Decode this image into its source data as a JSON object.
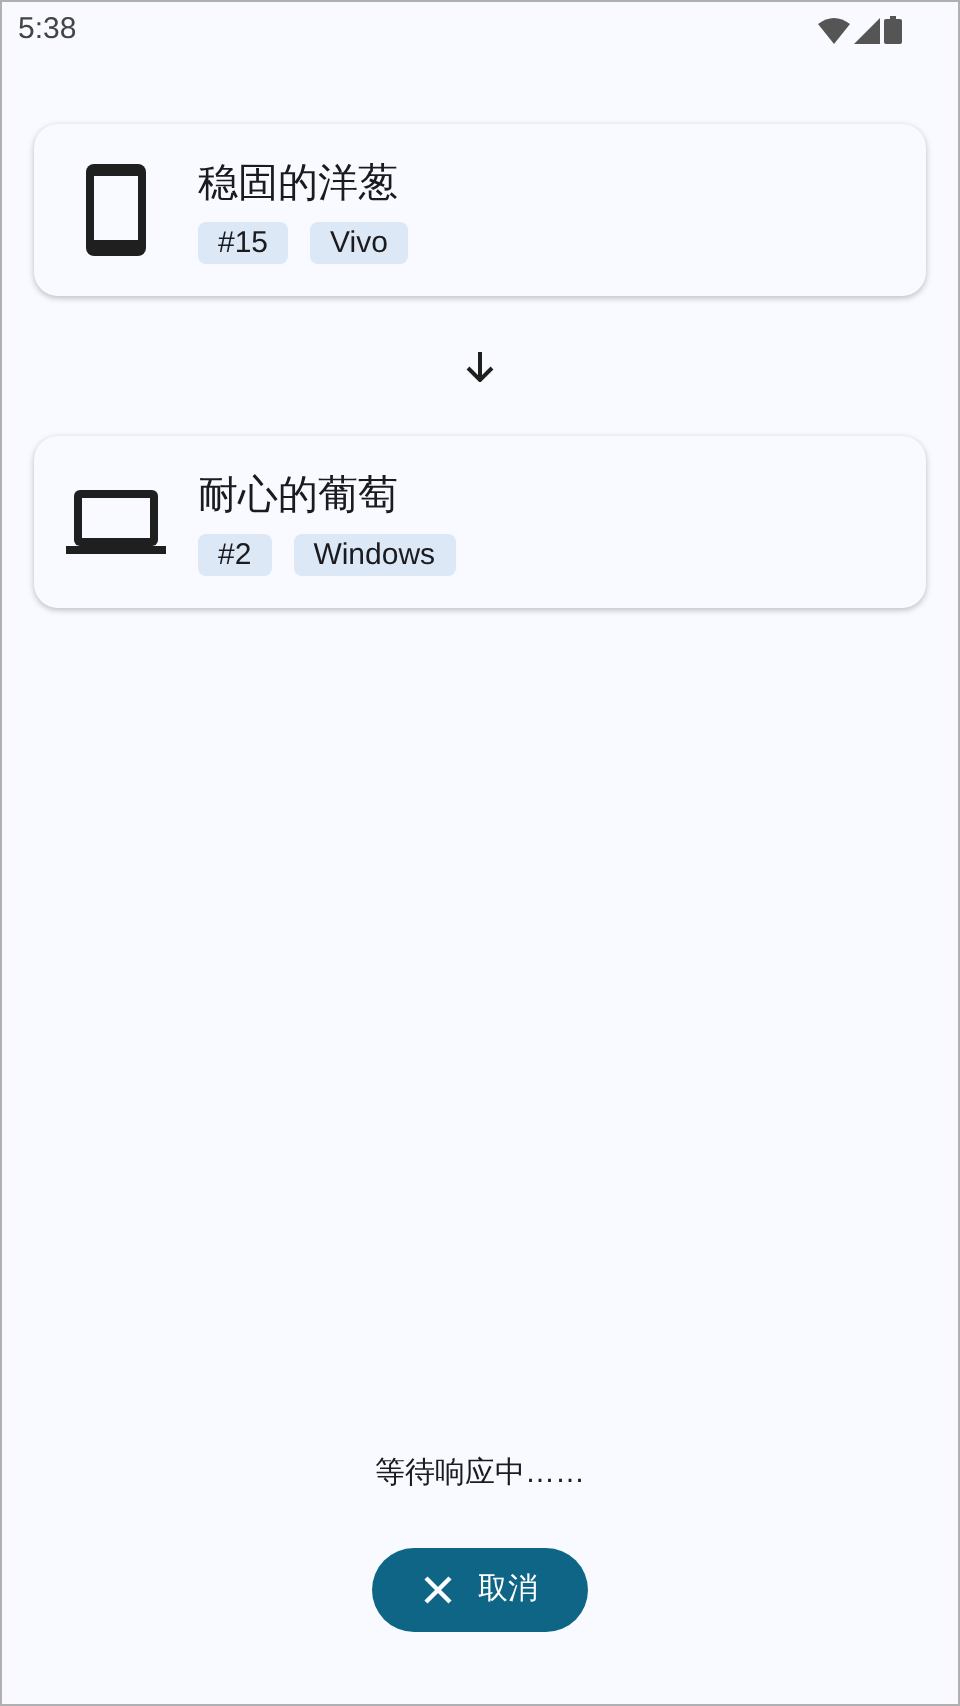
{
  "status_bar": {
    "time": "5:38"
  },
  "devices": [
    {
      "kind": "phone",
      "name": "稳固的洋葱",
      "tags": [
        "#15",
        "Vivo"
      ]
    },
    {
      "kind": "laptop",
      "name": "耐心的葡萄",
      "tags": [
        "#2",
        "Windows"
      ]
    }
  ],
  "status_text": "等待响应中……",
  "cancel_button": {
    "label": "取消"
  }
}
